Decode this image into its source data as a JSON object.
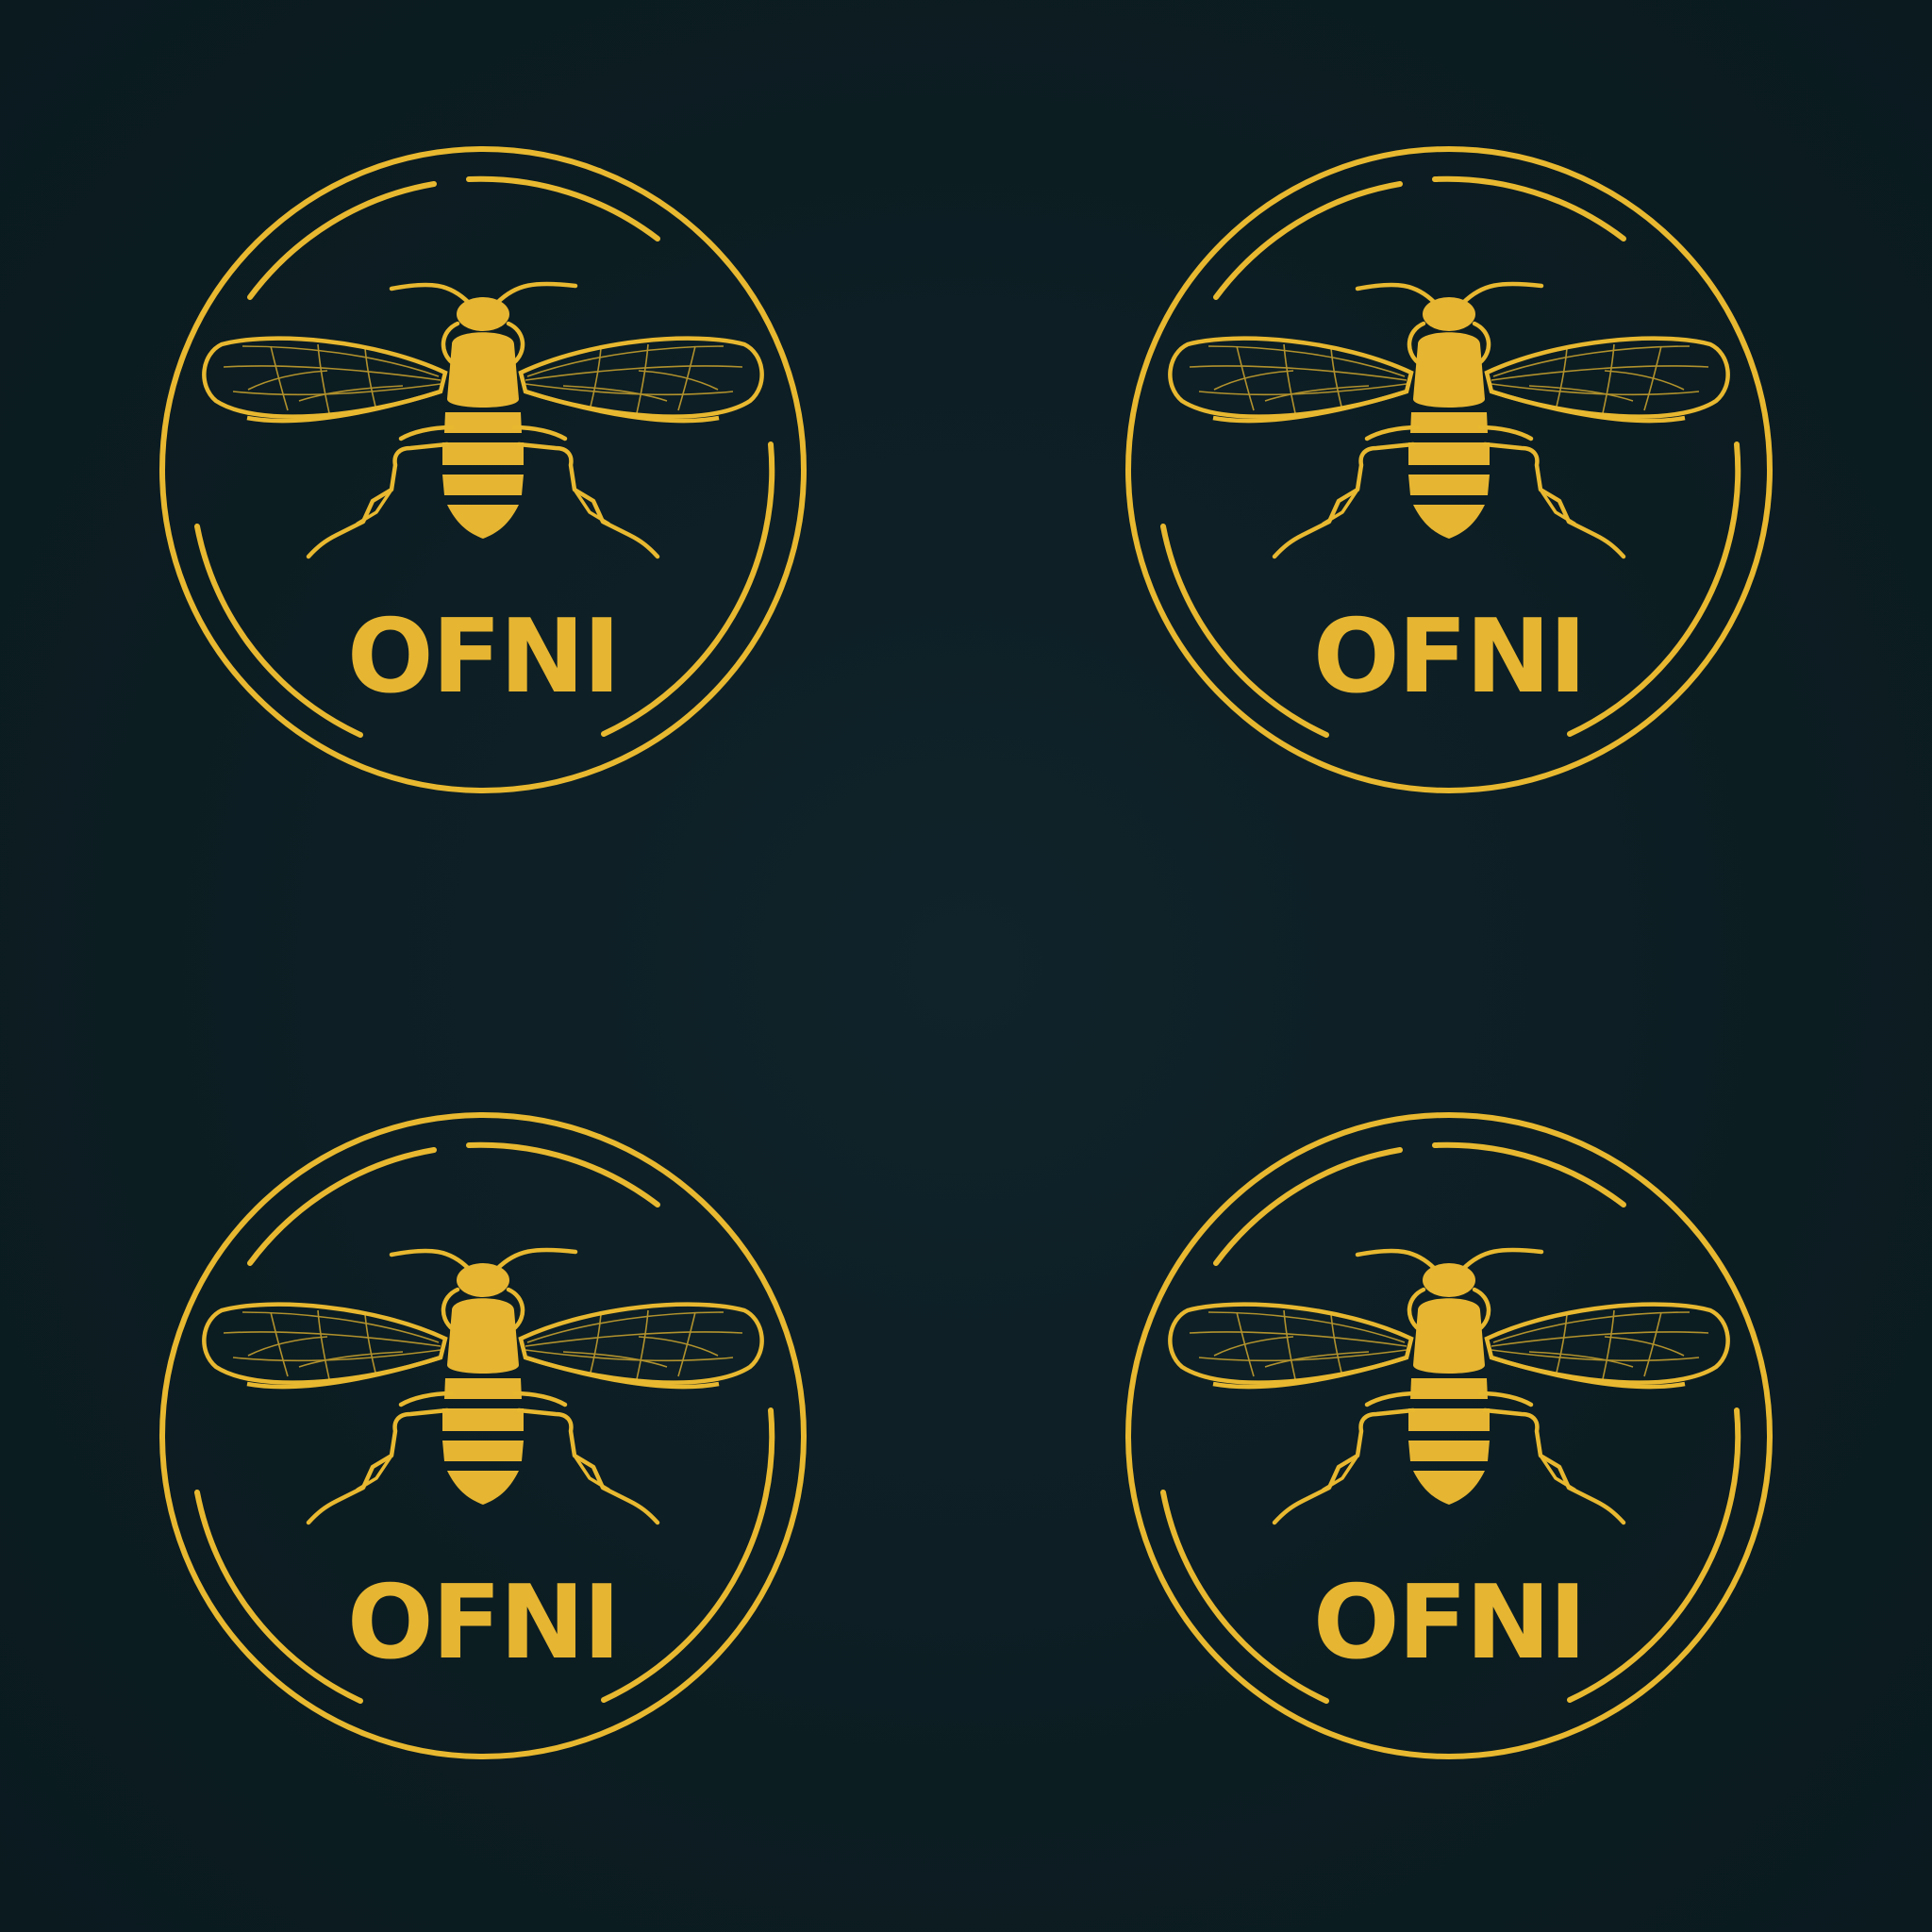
{
  "colors": {
    "background": "#0c1d22",
    "gold": "#e8b830",
    "gold_fill": "#e6b532"
  },
  "icon": "bee-icon",
  "emblems": [
    {
      "wordmark": "OFNI"
    },
    {
      "wordmark": "OFNI"
    },
    {
      "wordmark": "OFNI"
    },
    {
      "wordmark": "OFNI"
    }
  ]
}
